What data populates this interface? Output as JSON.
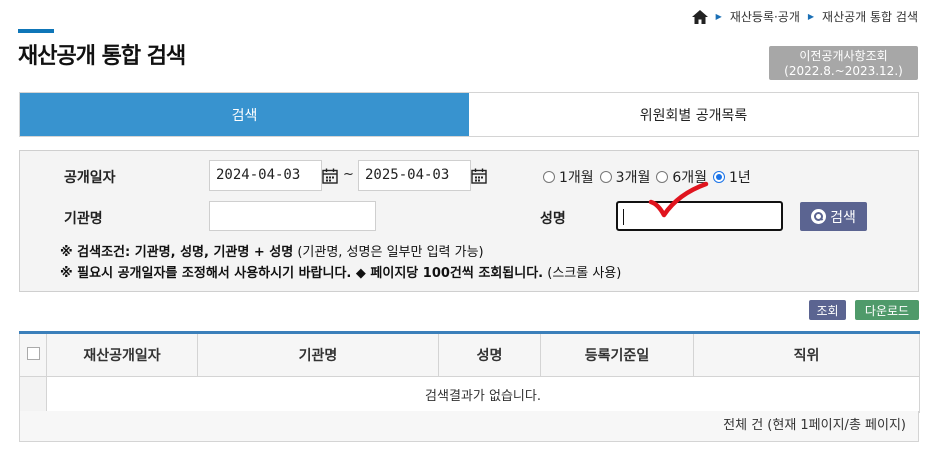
{
  "breadcrumb": {
    "home_icon": "home-icon",
    "items": [
      "재산등록·공개",
      "재산공개 통합 검색"
    ]
  },
  "page": {
    "title": "재산공개 통합 검색",
    "prev_button_line1": "이전공개사항조회",
    "prev_button_line2": "(2022.8.~2023.12.)"
  },
  "tabs": [
    {
      "label": "검색",
      "active": true
    },
    {
      "label": "위원회별 공개목록",
      "active": false
    }
  ],
  "search": {
    "date_label": "공개일자",
    "date_from": "2024-04-03",
    "date_to": "2025-04-03",
    "tilde": "~",
    "periods": [
      {
        "label": "1개월",
        "checked": false
      },
      {
        "label": "3개월",
        "checked": false
      },
      {
        "label": "6개월",
        "checked": false
      },
      {
        "label": "1년",
        "checked": true
      }
    ],
    "org_label": "기관명",
    "org_value": "",
    "name_label": "성명",
    "name_value": "",
    "search_button": "검색",
    "note1_bold": "※ 검색조건: 기관명, 성명, 기관명 + 성명",
    "note1_plain": " (기관명, 성명은 일부만 입력 가능)",
    "note2_bold": "※ 필요시 공개일자를 조정해서 사용하시기 바랍니다. ◆ 페이지당 100건씩 조회됩니다.",
    "note2_plain": " (스크롤 사용)"
  },
  "actions": {
    "query": "조회",
    "download": "다운로드"
  },
  "table": {
    "headers": [
      "재산공개일자",
      "기관명",
      "성명",
      "등록기준일",
      "직위"
    ],
    "empty_message": "검색결과가 없습니다.",
    "footer": "전체 건 (현재 1페이지/총 페이지)"
  },
  "colors": {
    "accent": "#3893cf",
    "button": "#5b6491",
    "download": "#4f9a6a",
    "annotation": "#e0141e"
  }
}
